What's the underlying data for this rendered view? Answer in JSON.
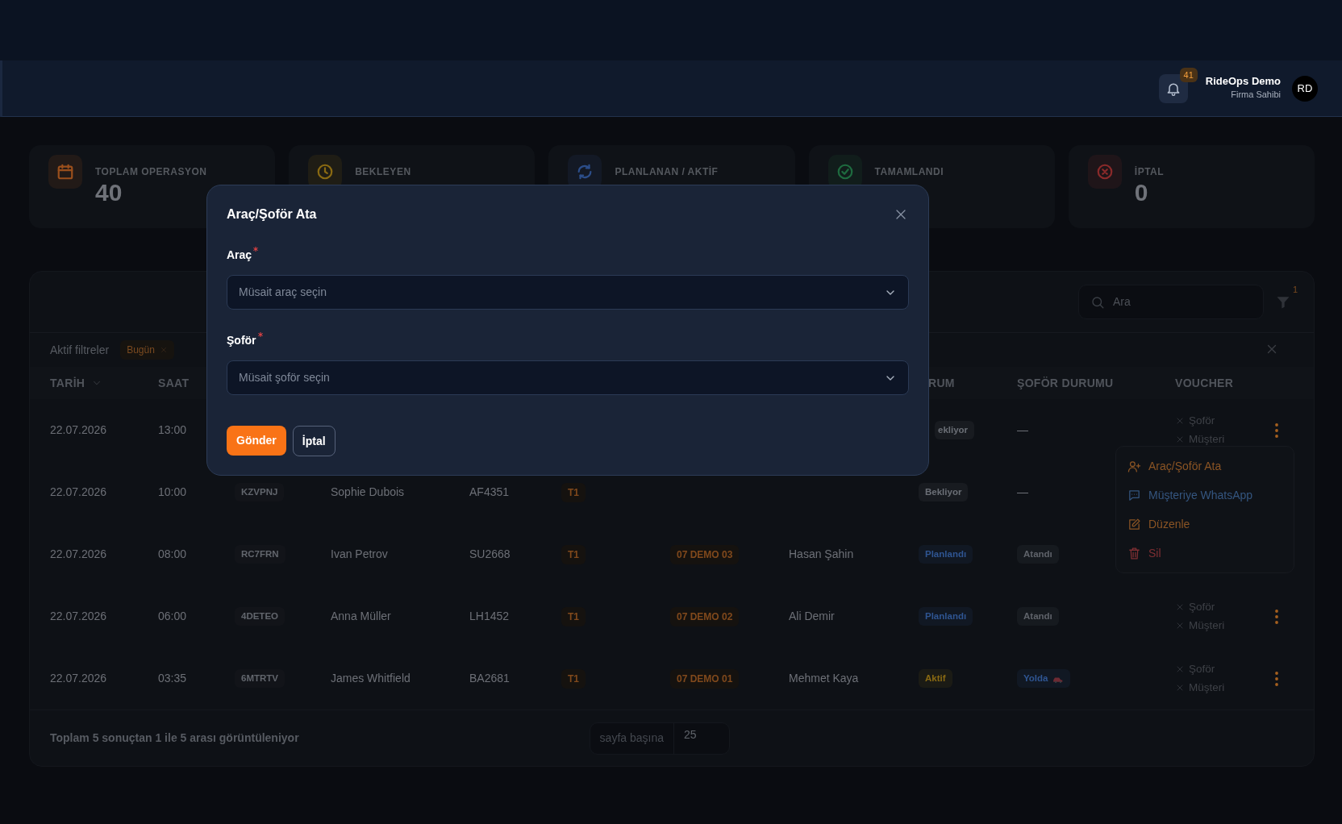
{
  "header": {
    "notifications": "41",
    "user_name": "RideOps Demo",
    "user_role": "Firma Sahibi",
    "avatar": "RD"
  },
  "stats": [
    {
      "label": "TOPLAM OPERASYON",
      "value": "40",
      "kind": "calendar",
      "color": "#9a4f1c"
    },
    {
      "label": "BEKLEYEN",
      "kind": "clock",
      "color": "#8a6a12"
    },
    {
      "label": "PLANLANAN / AKTİF",
      "kind": "refresh",
      "color": "#2c4e8a"
    },
    {
      "label": "TAMAMLANDI",
      "kind": "check",
      "color": "#1e6b3f"
    },
    {
      "label": "İPTAL",
      "value": "0",
      "kind": "cancel",
      "color": "#8a2a2a"
    }
  ],
  "table": {
    "search_placeholder": "Ara",
    "filter_count": "1",
    "active_filters_label": "Aktif filtreler",
    "filters": [
      {
        "label": "Bugün"
      }
    ],
    "columns": {
      "date": {
        "label": "TARİH",
        "sorted": true
      },
      "time": {
        "label": "SAAT",
        "sorted": false
      },
      "status": {
        "label": "RUM",
        "sorted": false
      },
      "driver_status": {
        "label": "ŞOFÖR DURUMU",
        "sorted": false
      },
      "voucher": {
        "label": "VOUCHER",
        "sorted": false
      }
    },
    "rows": [
      {
        "date": "22.07.2026",
        "time": "13:00",
        "status": {
          "text": "ekliyor",
          "color": "#6b6f76"
        },
        "driver_status": {
          "kind": "plain",
          "text": "—"
        },
        "voucher": [
          {
            "label": "Şoför"
          },
          {
            "label": "Müşteri"
          }
        ],
        "menu_button": true
      },
      {
        "date": "22.07.2026",
        "time": "10:00",
        "code": "KZVPNJ",
        "passenger": "Sophie Dubois",
        "flight": "AF4351",
        "terminal": "T1",
        "status": {
          "text": "Bekliyor",
          "color": "#6b6f76"
        },
        "driver_status": {
          "kind": "plain",
          "text": "—"
        }
      },
      {
        "date": "22.07.2026",
        "time": "08:00",
        "code": "RC7FRN",
        "passenger": "Ivan Petrov",
        "flight": "SU2668",
        "terminal": "T1",
        "vehicle": "07 DEMO 03",
        "driver": "Hasan Şahin",
        "status": {
          "text": "Planlandı",
          "color": "#2f5592"
        },
        "driver_status": {
          "kind": "badge",
          "text": "Atandı",
          "color": "#5f636a",
          "en_route": false
        }
      },
      {
        "date": "22.07.2026",
        "time": "06:00",
        "code": "4DETEO",
        "passenger": "Anna Müller",
        "flight": "LH1452",
        "terminal": "T1",
        "vehicle": "07 DEMO 02",
        "driver": "Ali Demir",
        "status": {
          "text": "Planlandı",
          "color": "#2f5592"
        },
        "driver_status": {
          "kind": "badge",
          "text": "Atandı",
          "color": "#5f636a",
          "en_route": false
        },
        "voucher": [
          {
            "label": "Şoför"
          },
          {
            "label": "Müşteri"
          }
        ],
        "menu_button": true
      },
      {
        "date": "22.07.2026",
        "time": "03:35",
        "code": "6MTRTV",
        "passenger": "James Whitfield",
        "flight": "BA2681",
        "terminal": "T1",
        "vehicle": "07 DEMO 01",
        "driver": "Mehmet Kaya",
        "status": {
          "text": "Aktif",
          "color": "#8a6a12"
        },
        "driver_status": {
          "kind": "badge",
          "text": "Yolda",
          "color": "#2f5592",
          "en_route": true
        },
        "voucher": [
          {
            "label": "Şoför"
          },
          {
            "label": "Müşteri"
          }
        ],
        "menu_button": true
      }
    ],
    "summary": "Toplam 5 sonuçtan 1 ile 5 arası görüntüleniyor",
    "per_page_label": "sayfa başına",
    "per_page": "25"
  },
  "row_menu": [
    {
      "label": "Araç/Şoför Ata",
      "kind": "assign",
      "color": "#8a5424"
    },
    {
      "label": "Müşteriye WhatsApp",
      "kind": "message",
      "color": "#34557f"
    },
    {
      "label": "Düzenle",
      "kind": "edit",
      "color": "#8a5424"
    },
    {
      "label": "Sil",
      "kind": "delete",
      "color": "#7f2f33"
    }
  ],
  "modal": {
    "title": "Araç/Şoför Ata",
    "fields": [
      {
        "label": "Araç",
        "required": true,
        "placeholder": "Müsait araç seçin"
      },
      {
        "label": "Şoför",
        "required": true,
        "placeholder": "Müsait şoför seçin"
      }
    ],
    "submit": "Gönder",
    "cancel": "İptal"
  }
}
